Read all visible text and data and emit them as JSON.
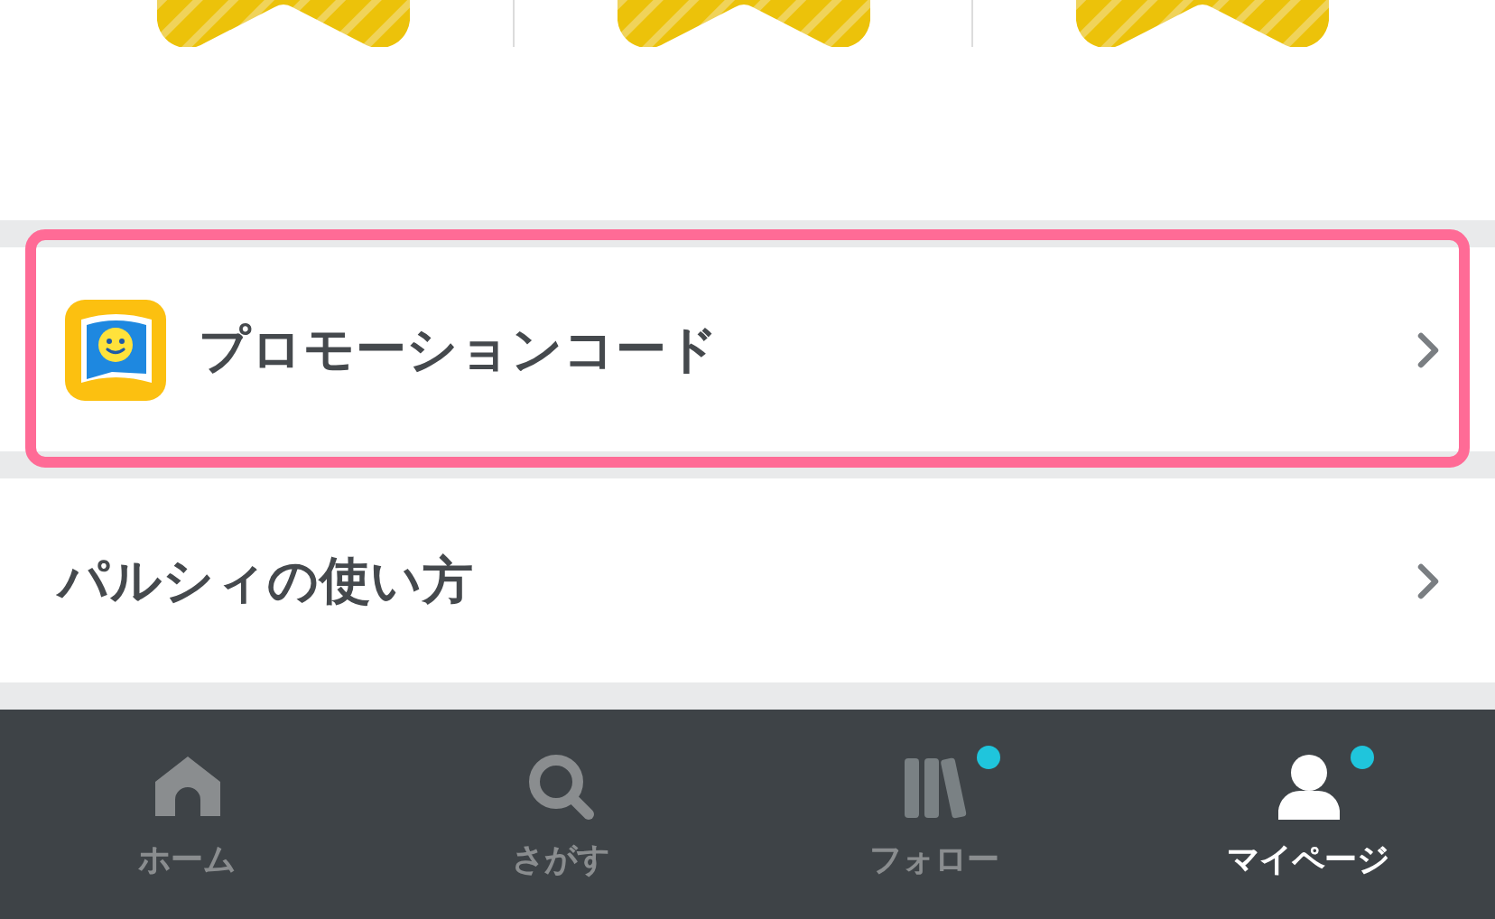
{
  "menu": [
    {
      "kind": "with-icon",
      "label": "プロモーションコード",
      "highlighted": true
    },
    {
      "kind": "plain",
      "label": "パルシィの使い方",
      "highlighted": false
    }
  ],
  "tab_bar": [
    {
      "label": "ホーム",
      "selected": false,
      "dot": false
    },
    {
      "label": "さがす",
      "selected": false,
      "dot": false
    },
    {
      "label": "フォロー",
      "selected": false,
      "dot": true
    },
    {
      "label": "マイページ",
      "selected": true,
      "dot": true
    }
  ]
}
